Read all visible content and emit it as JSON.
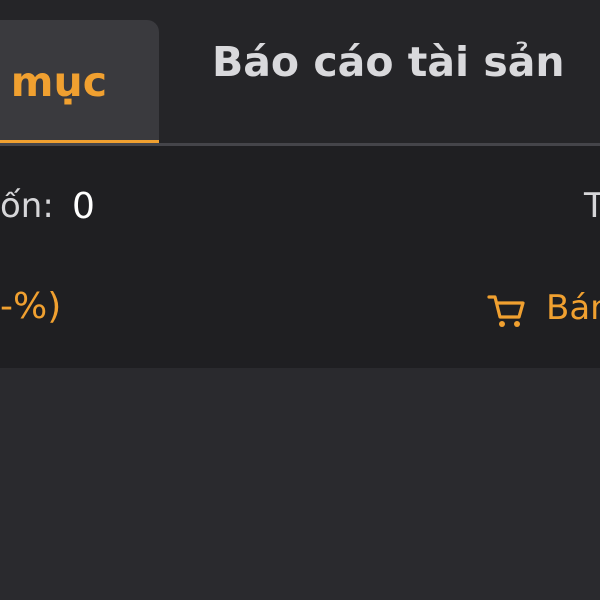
{
  "tabs": {
    "active_label": "mục",
    "asset_report_label": "Báo cáo tài sản"
  },
  "info": {
    "cost_label": "ốn:",
    "cost_value": "0",
    "right_label": "T",
    "percent_text": "-%)",
    "sell_label": "Bán"
  },
  "icons": {
    "sell_icon": "cart-icon"
  },
  "colors": {
    "accent": "#f0a030",
    "background": "#2a2a2e",
    "panel": "#1f1f22",
    "tab_active_bg": "#3a3a3e",
    "text_primary": "#ffffff",
    "text_secondary": "#d6d6d9"
  }
}
